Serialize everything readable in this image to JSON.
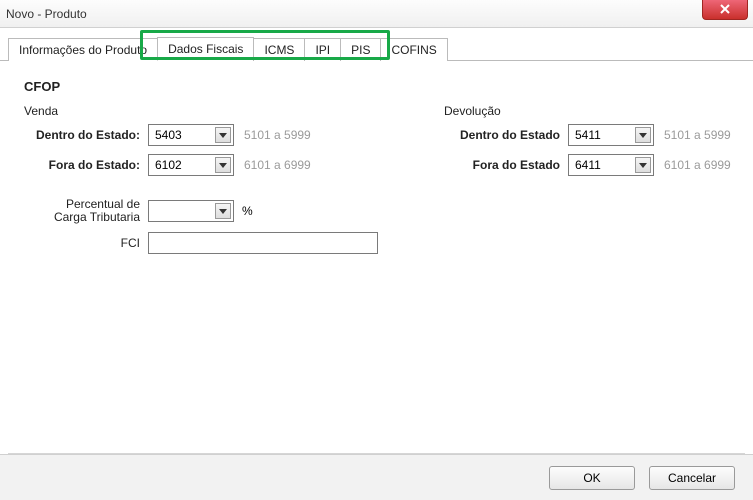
{
  "window": {
    "title": "Novo - Produto"
  },
  "tabs": {
    "informacoes": "Informações do Produto",
    "dados_fiscais": "Dados Fiscais",
    "icms": "ICMS",
    "ipi": "IPI",
    "pis": "PIS",
    "cofins": "COFINS"
  },
  "group": {
    "cfop": "CFOP"
  },
  "venda": {
    "title": "Venda",
    "dentro_label": "Dentro do Estado:",
    "dentro_value": "5403",
    "dentro_hint": "5101 a 5999",
    "fora_label": "Fora do Estado:",
    "fora_value": "6102",
    "fora_hint": "6101 a 6999"
  },
  "devolucao": {
    "title": "Devolução",
    "dentro_label": "Dentro do Estado",
    "dentro_value": "5411",
    "dentro_hint": "5101 a 5999",
    "fora_label": "Fora do Estado",
    "fora_value": "6411",
    "fora_hint": "6101 a 6999"
  },
  "extra": {
    "percentual_label_line1": "Percentual de",
    "percentual_label_line2": "Carga Tributaria",
    "percentual_value": "",
    "percent_sign": "%",
    "fci_label": "FCI",
    "fci_value": ""
  },
  "buttons": {
    "ok": "OK",
    "cancelar": "Cancelar"
  }
}
